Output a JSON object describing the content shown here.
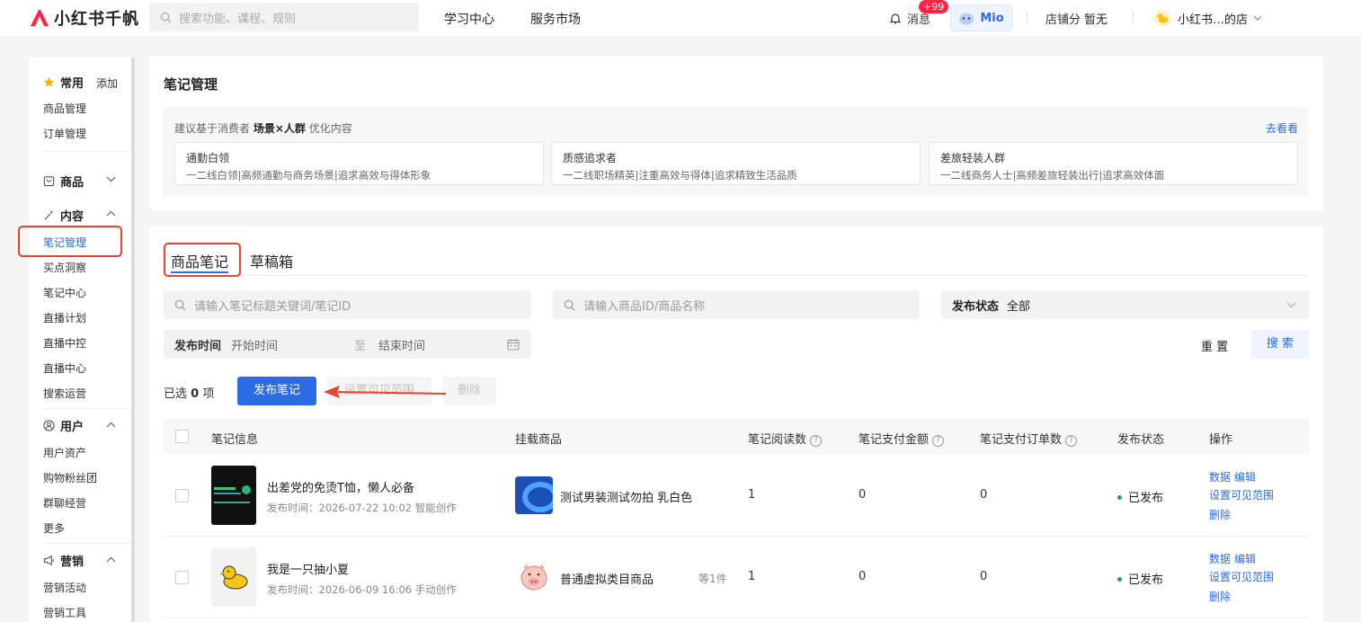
{
  "header": {
    "logo_text": "小红书千帆",
    "search_placeholder": "搜索功能、课程、规则",
    "nav": [
      "学习中心",
      "服务市场"
    ],
    "message_label": "消息",
    "message_badge": "+99",
    "mio_label": "Mio",
    "store_score_label": "店铺分",
    "store_score_value": "暂无",
    "shop_name": "小红书…的店"
  },
  "sidebar": {
    "favorites": {
      "title": "常用",
      "add_label": "添加",
      "items": [
        "商品管理",
        "订单管理"
      ]
    },
    "groups": [
      {
        "title": "商品",
        "items": []
      },
      {
        "title": "内容",
        "items": [
          "笔记管理",
          "买点洞察",
          "笔记中心",
          "直播计划",
          "直播中控",
          "直播中心",
          "搜索运营"
        ]
      },
      {
        "title": "用户",
        "items": [
          "用户资产",
          "购物粉丝团",
          "群聊经营",
          "更多"
        ]
      },
      {
        "title": "营销",
        "items": [
          "营销活动",
          "营销工具"
        ]
      }
    ],
    "active_item": "笔记管理"
  },
  "page": {
    "title": "笔记管理",
    "suggest_prefix": "建议基于消费者",
    "suggest_bold": "场景×人群",
    "suggest_suffix": "优化内容",
    "suggest_link": "去看看",
    "suggest_cards": [
      {
        "title": "通勤白领",
        "desc": "一二线白领|高频通勤与商务场景|追求高效与得体形象"
      },
      {
        "title": "质感追求者",
        "desc": "一二线职场精英|注重高效与得体|追求精致生活品质"
      },
      {
        "title": "差旅轻装人群",
        "desc": "一二线商务人士|高频差旅轻装出行|追求高效体面"
      }
    ]
  },
  "tabs": [
    "商品笔记",
    "草稿箱"
  ],
  "filters": {
    "note_placeholder": "请输入笔记标题关键词/笔记ID",
    "product_placeholder": "请输入商品ID/商品名称",
    "status_label": "发布状态",
    "status_value": "全部",
    "time_label": "发布时间",
    "start_placeholder": "开始时间",
    "range_sep": "至",
    "end_placeholder": "结束时间",
    "reset_label": "重 置",
    "search_label": "搜 索"
  },
  "toolbar": {
    "selected_prefix": "已选",
    "selected_count": "0",
    "selected_suffix": "项",
    "publish_label": "发布笔记",
    "visibility_label": "设置可见范围",
    "delete_label": "删除"
  },
  "table": {
    "headers": [
      "笔记信息",
      "挂载商品",
      "笔记阅读数",
      "笔记支付金额",
      "笔记支付订单数",
      "发布状态",
      "操作"
    ],
    "rows": [
      {
        "title": "出差党的免烫T恤，懒人必备",
        "meta": "发布时间：2026-07-22 10:02 智能创作",
        "product": "测试男装测试勿拍 乳白色",
        "product_extra": "",
        "reads": "1",
        "amount": "0",
        "orders": "0",
        "status": "已发布",
        "actions": [
          "数据",
          "编辑",
          "设置可见范围",
          "删除"
        ]
      },
      {
        "title": "我是一只抽小夏",
        "meta": "发布时间：2026-06-09 16:06 手动创作",
        "product": "普通虚拟类目商品",
        "product_extra": "等1件",
        "reads": "1",
        "amount": "0",
        "orders": "0",
        "status": "已发布",
        "actions": [
          "数据",
          "编辑",
          "设置可见范围",
          "删除"
        ]
      }
    ]
  },
  "colors": {
    "brand": "#ff2442",
    "primary": "#2b6be6",
    "annotation": "#e8412d",
    "success": "#1fa05a"
  }
}
